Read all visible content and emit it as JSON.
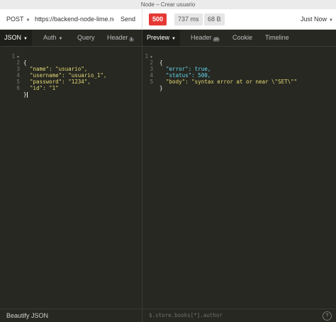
{
  "window": {
    "title": "Node – Crear usuario"
  },
  "request": {
    "method": "POST",
    "url": "https://backend-node-lime.now",
    "send_label": "Send"
  },
  "response": {
    "status": "500",
    "time": "737 ms",
    "size": "68 B",
    "history_label": "Just Now"
  },
  "request_tabs": [
    {
      "label": "JSON",
      "active": true
    },
    {
      "label": "Auth"
    },
    {
      "label": "Query"
    },
    {
      "label": "Header",
      "count": "1"
    }
  ],
  "response_tabs": [
    {
      "label": "Preview",
      "active": true
    },
    {
      "label": "Header",
      "count": "10"
    },
    {
      "label": "Cookie"
    },
    {
      "label": "Timeline"
    }
  ],
  "request_body": {
    "line_numbers": [
      "1",
      "2",
      "3",
      "4",
      "5",
      "6"
    ],
    "lines": [
      "{",
      "  \"name\": \"usuario\",",
      "  \"username\": \"usuario_1\",",
      "  \"password\": \"1234\",",
      "  \"id\": \"1\"",
      "}"
    ]
  },
  "response_body": {
    "line_numbers": [
      "1",
      "2",
      "3",
      "4",
      "5"
    ],
    "lines": [
      "{",
      "  \"error\": true,",
      "  \"status\": 500,",
      "  \"body\": \"syntax error at or near \\\"SET\\\"\"",
      "}"
    ]
  },
  "footer": {
    "beautify_label": "Beautify JSON",
    "filter_placeholder": "$.store.books[*].author",
    "help_label": "?"
  },
  "colors": {
    "status_error": "#e53935",
    "json_key": "#66d9ef",
    "json_string": "#e6db74",
    "json_literal": "#ae81ff",
    "editor_bg": "#272822"
  }
}
